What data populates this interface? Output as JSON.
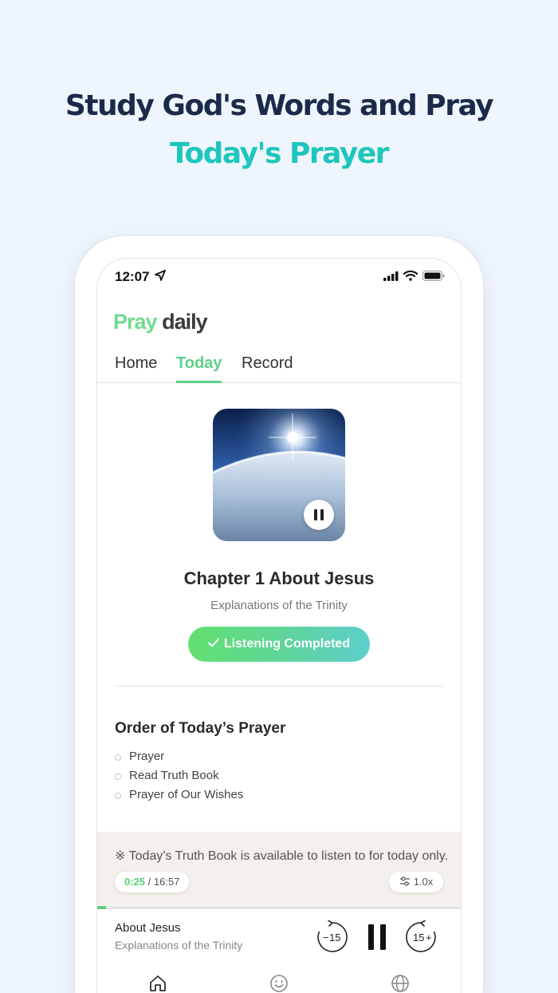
{
  "hero": {
    "title": "Study God's Words and Pray",
    "subtitle": "Today's Prayer"
  },
  "status_bar": {
    "time": "12:07",
    "icons": [
      "location-arrow-icon",
      "signal-icon",
      "wifi-icon",
      "battery-icon"
    ]
  },
  "logo": {
    "part1": "Pray",
    "part2": "daily"
  },
  "tabs": [
    {
      "label": "Home",
      "active": false
    },
    {
      "label": "Today",
      "active": true
    },
    {
      "label": "Record",
      "active": false
    }
  ],
  "episode": {
    "title": "Chapter 1 About Jesus",
    "subtitle": "Explanations of the Trinity",
    "artwork_icon": "earth-sunrise-artwork",
    "status_button": "Listening Completed"
  },
  "order": {
    "title": "Order of Today’s Prayer",
    "items": [
      "Prayer",
      "Read Truth Book",
      "Prayer of Our Wishes"
    ]
  },
  "notice": {
    "text": "※ Today’s Truth Book is available to listen to for today only."
  },
  "player": {
    "current_time": "0:25",
    "separator": " / ",
    "total_time": "16:57",
    "speed": "1.0x",
    "progress": 0.025,
    "track_title": "About Jesus",
    "track_subtitle": "Explanations of the Trinity",
    "rewind_label": "15",
    "forward_label": "15"
  },
  "colors": {
    "accent_green": "#5fd08a",
    "headline": "#1c2a4a",
    "subheadline": "#1ec6bd"
  },
  "bottom_nav": [
    "home-icon",
    "smile-icon",
    "globe-icon"
  ]
}
